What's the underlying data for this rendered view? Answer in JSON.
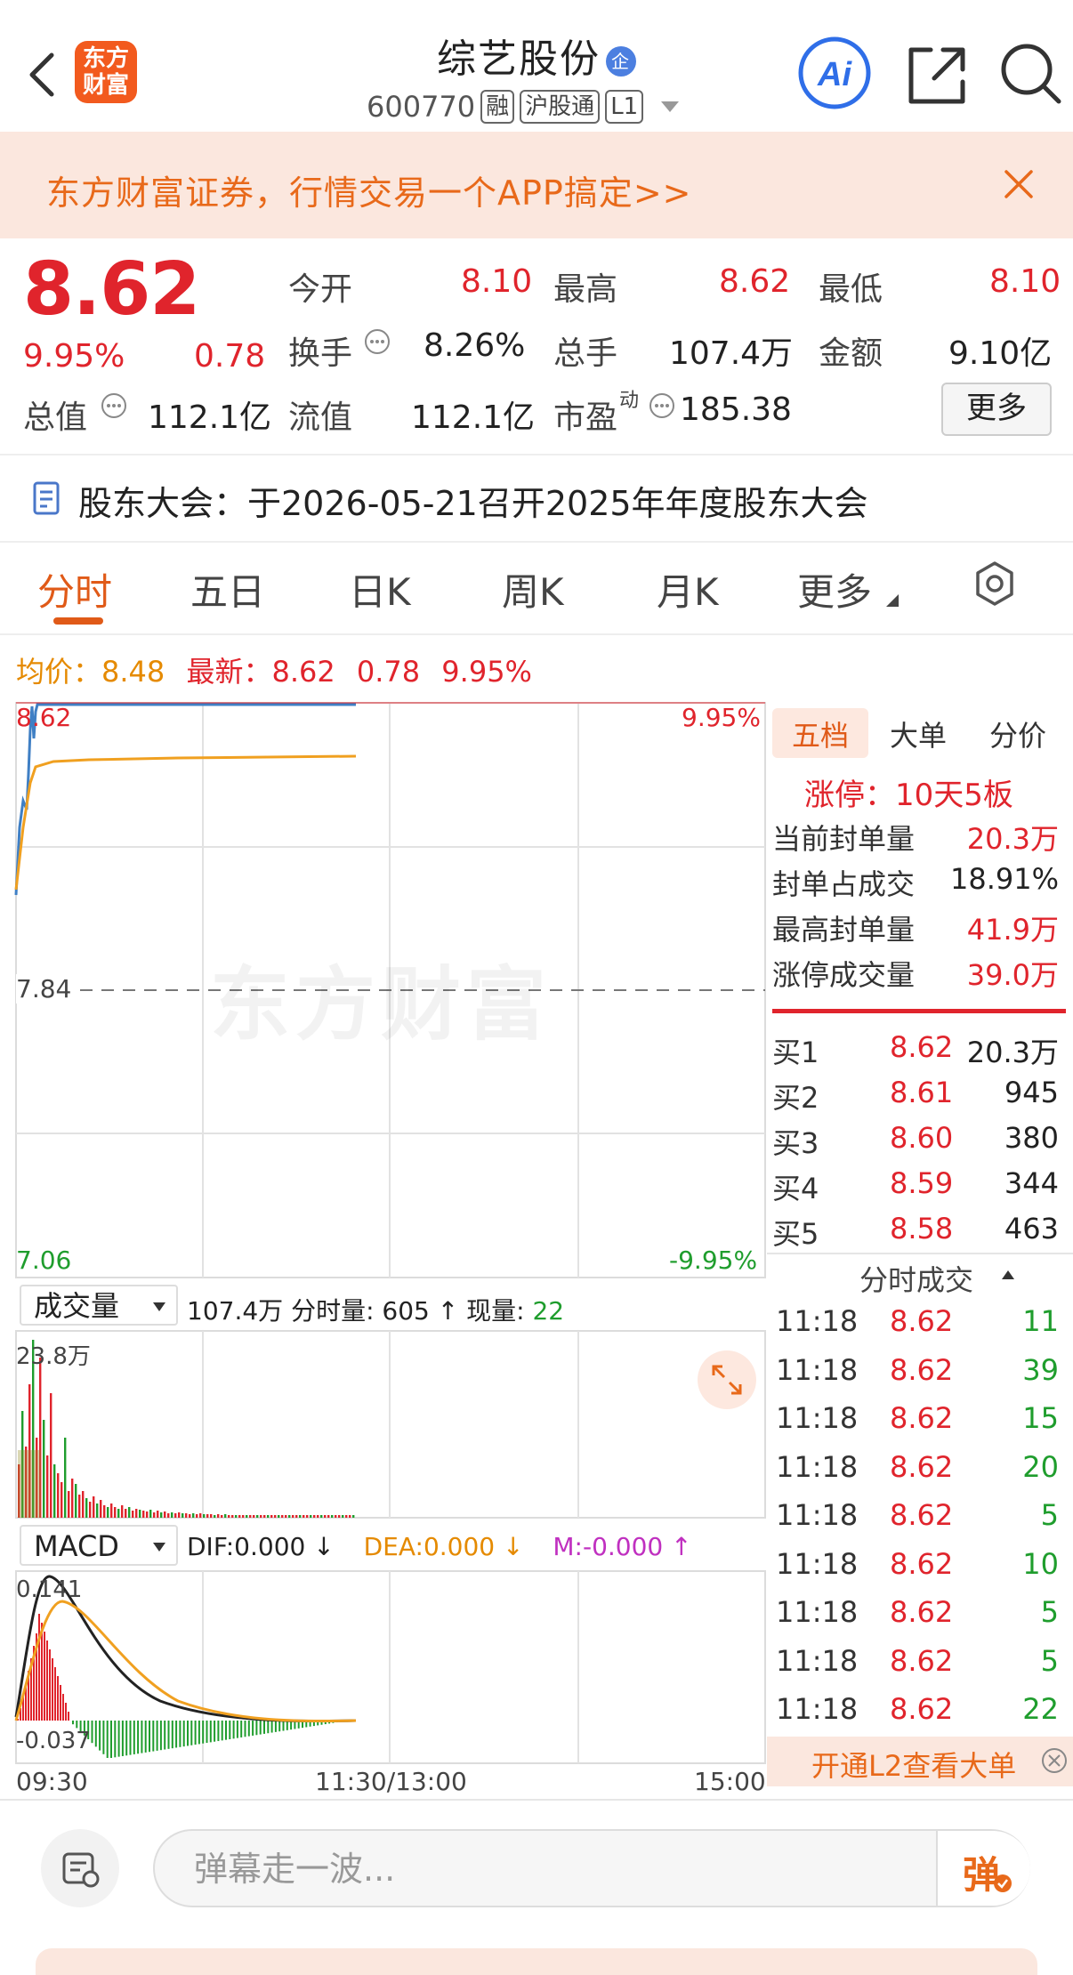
{
  "header": {
    "logo_text_1": "东方",
    "logo_text_2": "财富",
    "stock_name": "综艺股份",
    "qi_badge": "企",
    "stock_code": "600770",
    "tags": [
      "融",
      "沪股通",
      "L1"
    ]
  },
  "banner": {
    "text": "东方财富证券，行情交易一个APP搞定>>"
  },
  "quote": {
    "price": "8.62",
    "change_pct": "9.95%",
    "change_amt": "0.78",
    "open_label": "今开",
    "open": "8.10",
    "high_label": "最高",
    "high": "8.62",
    "low_label": "最低",
    "low": "8.10",
    "turnover_label": "换手",
    "turnover": "8.26%",
    "volume_label": "总手",
    "volume": "107.4万",
    "amount_label": "金额",
    "amount": "9.10亿",
    "mcap_label": "总值",
    "mcap": "112.1亿",
    "float_label": "流值",
    "float_cap": "112.1亿",
    "pe_label": "市盈",
    "pe_sup": "动",
    "pe": "185.38",
    "more": "更多"
  },
  "notice": {
    "text": "股东大会：于2026-05-21召开2025年年度股东大会"
  },
  "tabs": [
    {
      "label": "分时"
    },
    {
      "label": "五日"
    },
    {
      "label": "日K"
    },
    {
      "label": "周K"
    },
    {
      "label": "月K"
    },
    {
      "label": "更多"
    }
  ],
  "avg_line": {
    "avg_label": "均价：",
    "avg_value": "8.48",
    "latest_label": "最新：",
    "latest_value": "8.62",
    "latest_chg": "0.78",
    "latest_pct": "9.95%"
  },
  "chart": {
    "y_top": "8.62",
    "y_mid": "7.84",
    "y_bottom": "7.06",
    "pct_top": "9.95%",
    "pct_bottom": "-9.95%",
    "x_labels": [
      "09:30",
      "11:30/13:00",
      "15:00"
    ],
    "watermark": "东方财富",
    "colors": {
      "price_line": "#3f7fc4",
      "avg_line": "#f0a020",
      "up": "#e0242c",
      "down": "#1f9d2d"
    }
  },
  "volume": {
    "selector": "成交量",
    "total": "107.4万",
    "minute_label": "分时量:",
    "minute_value": "605",
    "current_label": "现量:",
    "current_value": "22",
    "y_max": "23.8万"
  },
  "macd": {
    "selector": "MACD",
    "dif": "DIF:0.000 ↓",
    "dea": "DEA:0.000 ↓",
    "m": "M:-0.000 ↑",
    "y_top": "0.141",
    "y_bottom": "-0.037"
  },
  "right_panel": {
    "tabs": [
      "五档",
      "大单",
      "分价"
    ],
    "limit_up": "涨停：10天5板",
    "stats": [
      {
        "label": "当前封单量",
        "value": "20.3万"
      },
      {
        "label": "封单占成交",
        "value": "18.91%"
      },
      {
        "label": "最高封单量",
        "value": "41.9万"
      },
      {
        "label": "涨停成交量",
        "value": "39.0万"
      }
    ],
    "bids": [
      {
        "label": "买1",
        "price": "8.62",
        "vol": "20.3万"
      },
      {
        "label": "买2",
        "price": "8.61",
        "vol": "945"
      },
      {
        "label": "买3",
        "price": "8.60",
        "vol": "380"
      },
      {
        "label": "买4",
        "price": "8.59",
        "vol": "344"
      },
      {
        "label": "买5",
        "price": "8.58",
        "vol": "463"
      }
    ],
    "ticks_title": "分时成交",
    "ticks": [
      {
        "time": "11:18",
        "price": "8.62",
        "vol": "11"
      },
      {
        "time": "11:18",
        "price": "8.62",
        "vol": "39"
      },
      {
        "time": "11:18",
        "price": "8.62",
        "vol": "15"
      },
      {
        "time": "11:18",
        "price": "8.62",
        "vol": "20"
      },
      {
        "time": "11:18",
        "price": "8.62",
        "vol": "5"
      },
      {
        "time": "11:18",
        "price": "8.62",
        "vol": "10"
      },
      {
        "time": "11:18",
        "price": "8.62",
        "vol": "5"
      },
      {
        "time": "11:18",
        "price": "8.62",
        "vol": "5"
      },
      {
        "time": "11:18",
        "price": "8.62",
        "vol": "22"
      }
    ],
    "l2_text": "开通L2查看大单"
  },
  "bottom": {
    "placeholder": "弹幕走一波...",
    "dan": "弹"
  }
}
